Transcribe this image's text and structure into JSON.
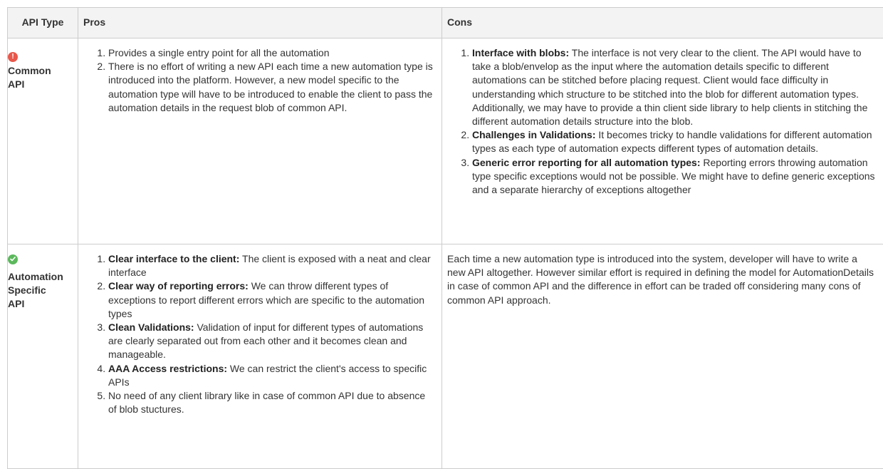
{
  "table": {
    "headers": [
      "API Type",
      "Pros",
      "Cons"
    ],
    "rows": [
      {
        "status": "error",
        "type_line1": "Common",
        "type_line2": "API",
        "type_line3": "",
        "pros": [
          {
            "bold": "",
            "text": "Provides a single entry point for all the automation"
          },
          {
            "bold": "",
            "text": "There is no effort of writing a new API each time a new automation type is introduced into the platform. However, a new model specific to the automation type will have to be introduced to enable the client to pass the automation details in the request blob of common API."
          }
        ],
        "cons": [
          {
            "bold": "Interface with blobs:",
            "text": " The interface is not very clear to the client. The API would have to take a blob/envelop as the input where the automation details specific to different automations can be stitched before placing request. Client would face difficulty in understanding which structure to be stitched into the blob for different automation types. Additionally, we may have to provide a thin client side library to help clients in stitching the different automation details structure into the blob."
          },
          {
            "bold": "Challenges in Validations:",
            "text": " It becomes tricky to handle validations for different automation types as each type of automation expects different types of automation details."
          },
          {
            "bold": "Generic error reporting for all automation types:",
            "text": " Reporting errors throwing automation type specific exceptions would not be possible. We might have to define generic exceptions and a separate hierarchy of exceptions altogether"
          }
        ]
      },
      {
        "status": "ok",
        "type_line1": "Automation",
        "type_line2": "Specific",
        "type_line3": "API",
        "pros": [
          {
            "bold": "Clear interface to the client:",
            "text": " The client is exposed with a neat and clear interface"
          },
          {
            "bold": "Clear way of reporting errors:",
            "text": " We can throw different types of exceptions to report different errors which are specific to the automation types"
          },
          {
            "bold": "Clean Validations:",
            "text": " Validation of input for different types of automations are clearly separated out from each other and it becomes clean and manageable."
          },
          {
            "bold": "AAA Access restrictions:",
            "text": " We can restrict the client's access to specific APIs"
          },
          {
            "bold": "",
            "text": "No need of any client library like in case of common API due to absence of blob stuctures."
          }
        ],
        "cons_text": "Each time a new automation type is introduced into the system, developer will have to write a new API altogether. However similar effort is required in defining the model for AutomationDetails in case of common API and the difference in effort can be traded off considering many cons of common API approach."
      }
    ]
  },
  "colors": {
    "error": "#e8584b",
    "ok": "#5cb85c",
    "header_bg": "#f3f3f3",
    "border": "#cccccc"
  },
  "icons": {
    "error": "exclamation-circle-icon",
    "ok": "check-circle-icon"
  }
}
